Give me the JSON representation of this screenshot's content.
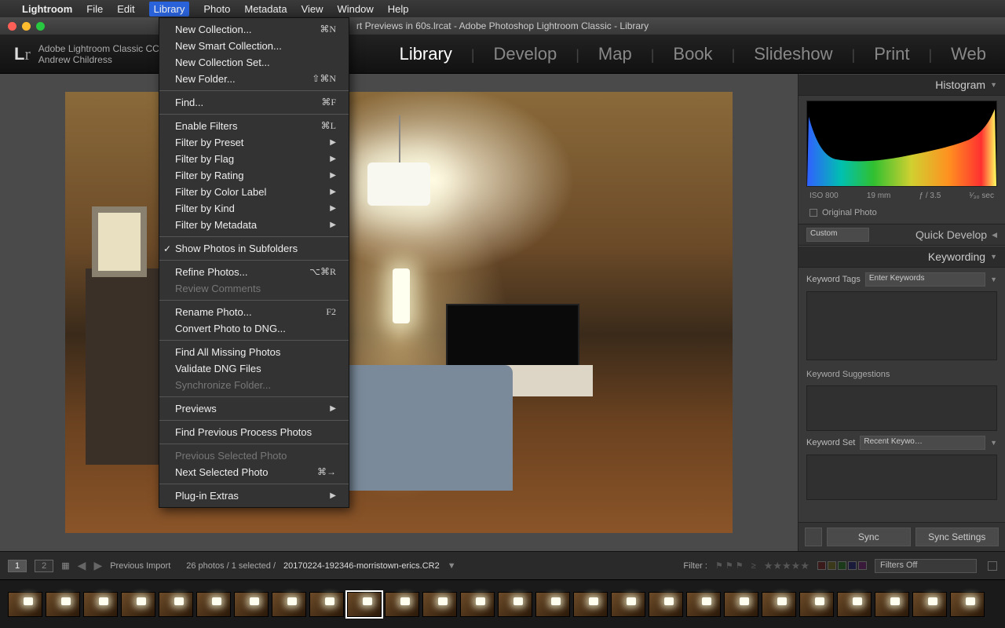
{
  "menubar": {
    "app": "Lightroom",
    "items": [
      "File",
      "Edit",
      "Library",
      "Photo",
      "Metadata",
      "View",
      "Window",
      "Help"
    ],
    "selected": "Library"
  },
  "window": {
    "title": "rt Previews in 60s.lrcat - Adobe Photoshop Lightroom Classic - Library"
  },
  "identity": {
    "product": "Adobe Lightroom Classic CC",
    "user": "Andrew Childress"
  },
  "modules": [
    "Library",
    "Develop",
    "Map",
    "Book",
    "Slideshow",
    "Print",
    "Web"
  ],
  "modules_active": "Library",
  "dropdown": [
    {
      "label": "New Collection...",
      "sc": "⌘N"
    },
    {
      "label": "New Smart Collection..."
    },
    {
      "label": "New Collection Set..."
    },
    {
      "label": "New Folder...",
      "sc": "⇧⌘N"
    },
    {
      "sep": true
    },
    {
      "label": "Find...",
      "sc": "⌘F"
    },
    {
      "sep": true
    },
    {
      "label": "Enable Filters",
      "sc": "⌘L"
    },
    {
      "label": "Filter by Preset",
      "sub": true
    },
    {
      "label": "Filter by Flag",
      "sub": true
    },
    {
      "label": "Filter by Rating",
      "sub": true
    },
    {
      "label": "Filter by Color Label",
      "sub": true
    },
    {
      "label": "Filter by Kind",
      "sub": true
    },
    {
      "label": "Filter by Metadata",
      "sub": true
    },
    {
      "sep": true
    },
    {
      "label": "Show Photos in Subfolders",
      "check": true
    },
    {
      "sep": true
    },
    {
      "label": "Refine Photos...",
      "sc": "⌥⌘R"
    },
    {
      "label": "Review Comments",
      "disabled": true
    },
    {
      "sep": true
    },
    {
      "label": "Rename Photo...",
      "sc": "F2"
    },
    {
      "label": "Convert Photo to DNG..."
    },
    {
      "sep": true
    },
    {
      "label": "Find All Missing Photos"
    },
    {
      "label": "Validate DNG Files"
    },
    {
      "label": "Synchronize Folder...",
      "disabled": true
    },
    {
      "sep": true
    },
    {
      "label": "Previews",
      "sub": true
    },
    {
      "sep": true
    },
    {
      "label": "Find Previous Process Photos"
    },
    {
      "sep": true
    },
    {
      "label": "Previous Selected Photo",
      "disabled": true
    },
    {
      "label": "Next Selected Photo",
      "sc": "⌘→"
    },
    {
      "sep": true
    },
    {
      "label": "Plug-in Extras",
      "sub": true
    }
  ],
  "right": {
    "histogram": "Histogram",
    "meta": {
      "iso": "ISO 800",
      "focal": "19 mm",
      "ap": "ƒ / 3.5",
      "shutter": "¹⁄₃₀ sec"
    },
    "original": "Original Photo",
    "qd_title": "Quick Develop",
    "qd_preset": "Custom",
    "kw_title": "Keywording",
    "kw_tags": "Keyword Tags",
    "kw_enter": "Enter Keywords",
    "kw_sugg": "Keyword Suggestions",
    "kw_set": "Keyword Set",
    "kw_recent": "Recent Keywo…",
    "sync": "Sync",
    "sync_settings": "Sync Settings"
  },
  "filterbar": {
    "page": "1",
    "page2": "2",
    "source": "Previous Import",
    "count": "26 photos / 1 selected /",
    "file": "20170224-192346-morristown-erics.CR2",
    "filter": "Filter :",
    "filters_off": "Filters Off"
  },
  "thumbs": 26
}
